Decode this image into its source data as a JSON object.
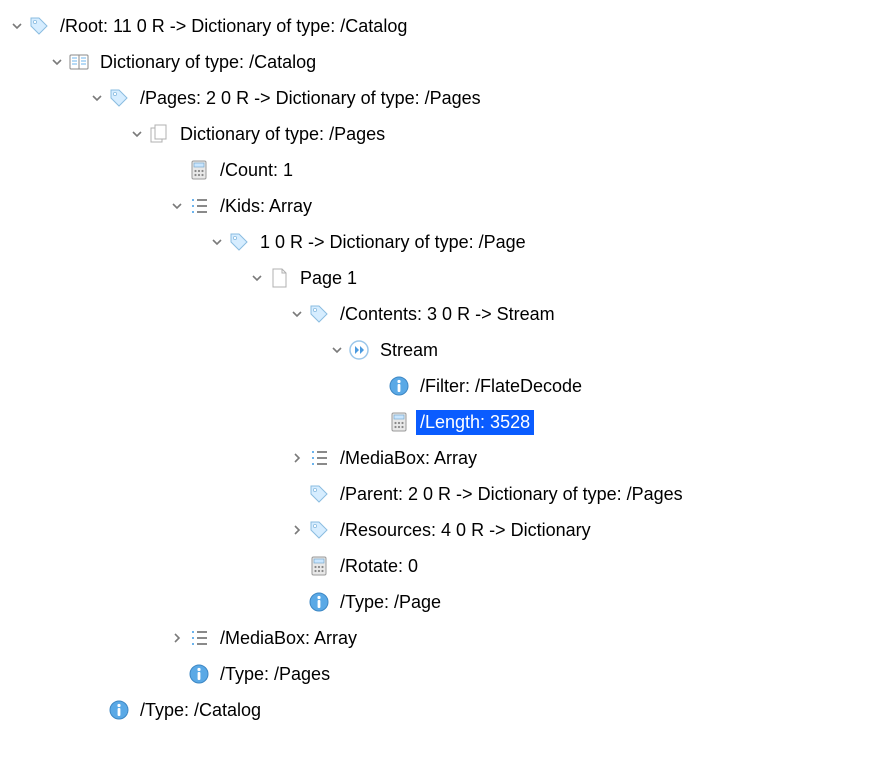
{
  "tree": {
    "root": {
      "label": "/Root: 11 0 R -> Dictionary of type: /Catalog",
      "catalog_dict": {
        "label": "Dictionary of type: /Catalog",
        "pages_ref": {
          "label": "/Pages: 2 0 R -> Dictionary of type: /Pages",
          "pages_dict": {
            "label": "Dictionary of type: /Pages",
            "count": {
              "label": "/Count: 1"
            },
            "kids": {
              "label": "/Kids: Array",
              "page_ref": {
                "label": "1 0 R -> Dictionary of type: /Page",
                "page1": {
                  "label": "Page 1",
                  "contents": {
                    "label": "/Contents: 3 0 R -> Stream",
                    "stream": {
                      "label": "Stream",
                      "filter": {
                        "label": "/Filter: /FlateDecode"
                      },
                      "length": {
                        "label": "/Length: 3528"
                      }
                    }
                  },
                  "mediabox": {
                    "label": "/MediaBox: Array"
                  },
                  "parent": {
                    "label": "/Parent: 2 0 R -> Dictionary of type: /Pages"
                  },
                  "resources": {
                    "label": "/Resources: 4 0 R -> Dictionary"
                  },
                  "rotate": {
                    "label": "/Rotate: 0"
                  },
                  "type": {
                    "label": "/Type: /Page"
                  }
                }
              }
            },
            "mediabox": {
              "label": "/MediaBox: Array"
            },
            "type": {
              "label": "/Type: /Pages"
            }
          }
        },
        "type": {
          "label": "/Type: /Catalog"
        }
      }
    }
  }
}
